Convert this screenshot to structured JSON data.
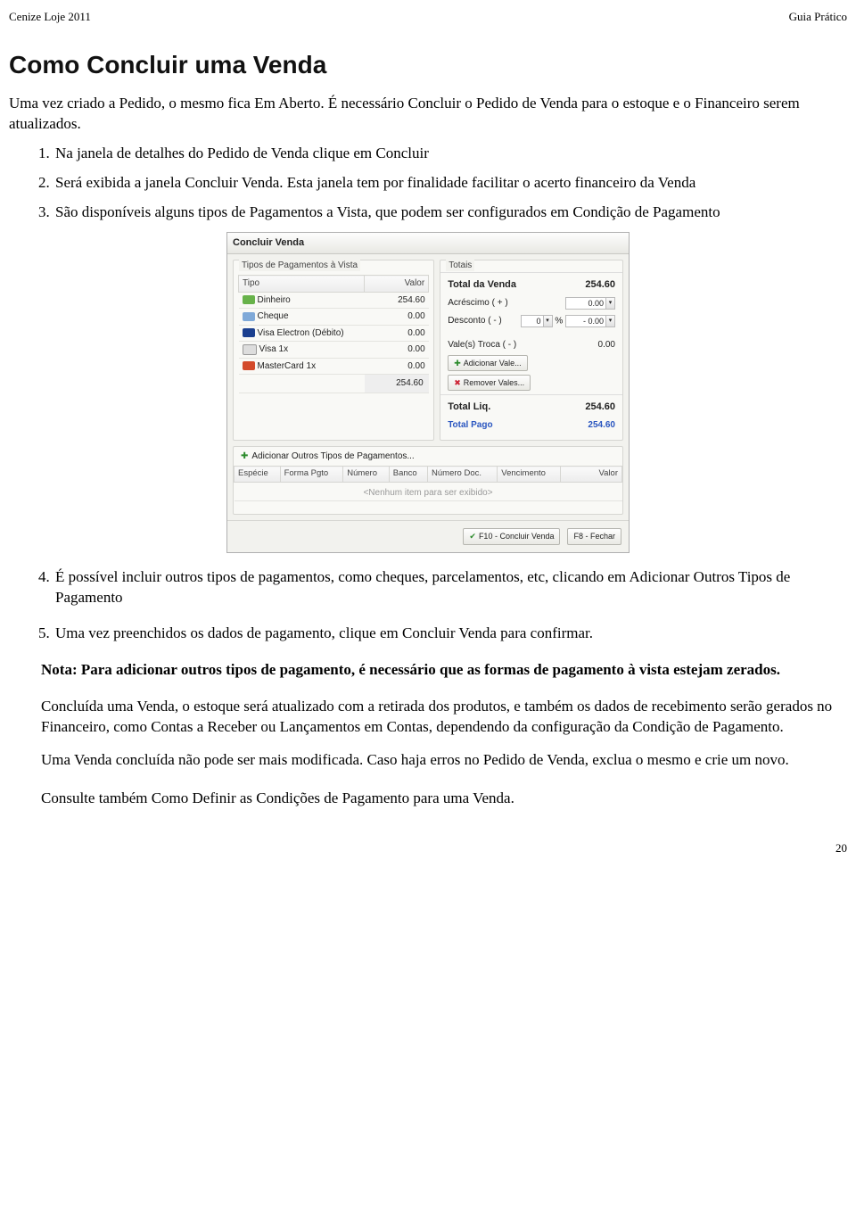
{
  "header": {
    "left": "Cenize Loje 2011",
    "right": "Guia Prático"
  },
  "title": "Como Concluir uma Venda",
  "intro": "Uma vez criado a Pedido, o mesmo fica Em Aberto. É necessário Concluir o Pedido de Venda para o estoque e o Financeiro serem atualizados.",
  "steps_a": [
    "Na janela de detalhes do Pedido de Venda clique em Concluir",
    "Será exibida a janela Concluir Venda. Esta janela tem por finalidade facilitar o acerto financeiro da Venda",
    "São disponíveis alguns tipos de Pagamentos a Vista, que podem ser configurados em Condição de Pagamento"
  ],
  "steps_b_start": 4,
  "steps_b": [
    "É possível incluir outros tipos de pagamentos, como cheques, parcelamentos, etc, clicando em Adicionar Outros Tipos de Pagamento",
    "Uma vez preenchidos os dados de pagamento, clique em Concluir Venda para confirmar."
  ],
  "note": "Nota: Para adicionar outros tipos de pagamento, é necessário que as formas de pagamento à vista estejam zerados.",
  "after": [
    "Concluída uma Venda, o estoque será atualizado com a retirada dos produtos, e também os dados de recebimento serão gerados no Financeiro, como Contas a Receber ou Lançamentos em Contas, dependendo da configuração da Condição de Pagamento.",
    "Uma Venda concluída não pode ser mais modificada. Caso haja erros no Pedido de Venda, exclua o mesmo e crie um novo."
  ],
  "seealso": "Consulte também Como Definir as Condições de Pagamento para uma Venda.",
  "pagenum": "20",
  "dialog": {
    "title": "Concluir Venda",
    "left_title": "Tipos de Pagamentos à Vista",
    "cols_left": {
      "tipo": "Tipo",
      "valor": "Valor"
    },
    "rows": [
      {
        "icon": "money-icon",
        "cls": "i-money",
        "name": "Dinheiro",
        "value": "254.60"
      },
      {
        "icon": "cheque-icon",
        "cls": "i-cheque",
        "name": "Cheque",
        "value": "0.00"
      },
      {
        "icon": "visa-debit-icon",
        "cls": "i-visa",
        "name": "Visa Electron (Débito)",
        "value": "0.00"
      },
      {
        "icon": "visa-1x-icon",
        "cls": "i-visa2",
        "name": "Visa 1x",
        "value": "0.00"
      },
      {
        "icon": "mastercard-icon",
        "cls": "i-mc",
        "name": "MasterCard 1x",
        "value": "0.00"
      }
    ],
    "left_total": "254.60",
    "right_title": "Totais",
    "totals": {
      "total_venda_label": "Total da Venda",
      "total_venda": "254.60",
      "acrescimo_label": "Acréscimo ( + )",
      "acrescimo": "0.00",
      "desconto_label": "Desconto ( - )",
      "desconto_pct": "0",
      "desconto_pct_unit": "%",
      "desconto": "- 0.00",
      "vales_label": "Vale(s) Troca ( - )",
      "vales": "0.00",
      "add_vale": "Adicionar Vale...",
      "rem_vale": "Remover Vales...",
      "total_liq_label": "Total Liq.",
      "total_liq": "254.60",
      "total_pago_label": "Total Pago",
      "total_pago": "254.60"
    },
    "addlink": "Adicionar Outros Tipos de Pagamentos...",
    "cols_bottom": [
      "Espécie",
      "Forma Pgto",
      "Número",
      "Banco",
      "Número Doc.",
      "Vencimento",
      "Valor"
    ],
    "placeholder": "<Nenhum item para ser exibido>",
    "btn_ok": "F10 - Concluir Venda",
    "btn_close": "F8 - Fechar"
  }
}
